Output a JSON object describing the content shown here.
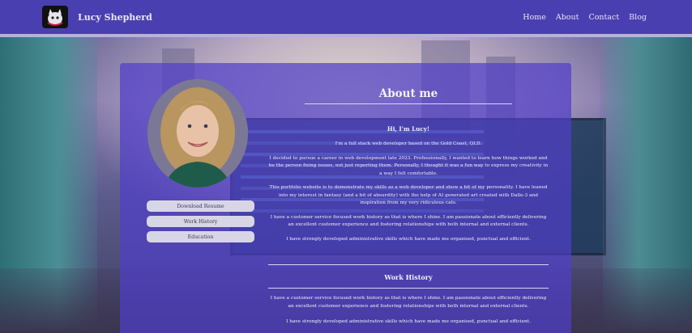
{
  "nav": {
    "brand": "Lucy Shepherd",
    "links": [
      "Home",
      "About",
      "Contact",
      "Blog"
    ],
    "logo_icon": "cat-logo-icon"
  },
  "sidebar": {
    "buttons": [
      "Download Resume",
      "Work History",
      "Education"
    ]
  },
  "about": {
    "title": "About me",
    "greeting": "Hi, I'm Lucy!",
    "paragraphs": [
      "I'm a full stack web developer based on the Gold Coast, QLD.",
      "I decided to pursue a career in web development late 2023. Professionally, I wanted to learn how things worked and be the person fixing issues, not just reporting them. Personally, I thought it was a fun way to express my creativity in a way I felt comfortable.",
      "This portfolio website is to demonstrate my skills as a web developer and show a bit of my personality. I have leaned into my interest in fantasy (and a bit of absurdity) with the help of AI generated art created with Dalle-3 and inspiration from my very ridiculous cats.",
      "I have a customer service focused work history as that is where I shine. I am passionate about efficiently delivering an excellent customer experience and fostering relationships with both internal and external clients.",
      "I have strongly developed administrative skills which have made me organised, punctual and efficient."
    ]
  },
  "work": {
    "title": "Work History",
    "paragraphs": [
      "I have a customer service focused work history as that is where I shine. I am passionate about efficiently delivering an excellent customer experience and fostering relationships with both internal and external clients.",
      "I have strongly developed administrative skills which have made me organised, punctual and efficient."
    ]
  },
  "colors": {
    "nav_bg": "#4a3fb0",
    "card_bg": "rgba(80,62,200,0.72)",
    "button_bg": "#d8d6e6"
  }
}
